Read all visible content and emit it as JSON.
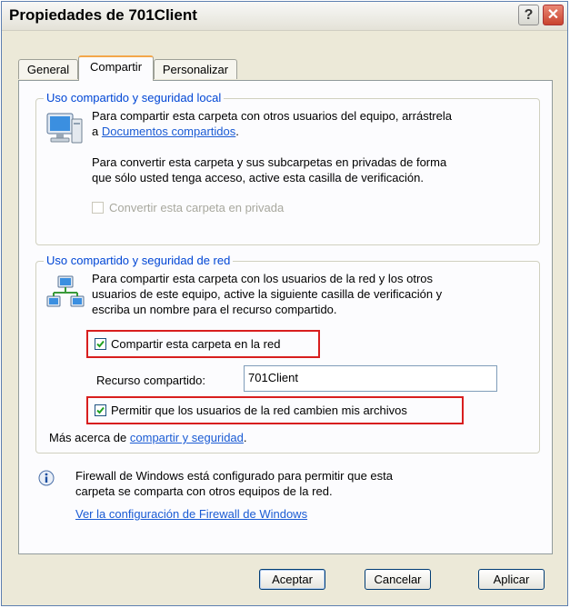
{
  "window": {
    "title": "Propiedades de 701Client",
    "help_symbol": "?",
    "close_symbol": "✕"
  },
  "tabs": [
    {
      "label": "General"
    },
    {
      "label": "Compartir",
      "active": true
    },
    {
      "label": "Personalizar"
    }
  ],
  "local": {
    "legend": "Uso compartido y seguridad local",
    "text1": "Para compartir esta carpeta con otros usuarios del equipo, arrástrela",
    "text1_prefix": "a",
    "link": "Documentos compartidos",
    "text1_suffix": ".",
    "text2_line1": "Para convertir esta carpeta y sus subcarpetas en privadas de forma",
    "text2_line2": "que sólo usted tenga acceso, active esta casilla de verificación.",
    "private_checkbox": "Convertir esta carpeta en privada"
  },
  "network": {
    "legend": "Uso compartido y seguridad de red",
    "text_line1": "Para compartir esta carpeta con los usuarios de la red y los otros",
    "text_line2": "usuarios de este equipo, active la siguiente casilla de verificación y",
    "text_line3": "escriba un nombre para el recurso compartido.",
    "share_checkbox": "Compartir esta carpeta en la red",
    "share_checked": true,
    "resource_label": "Recurso compartido:",
    "resource_value": "701Client",
    "allow_checkbox": "Permitir que los usuarios de la red cambien mis archivos",
    "allow_checked": true,
    "more_prefix": "Más acerca de",
    "more_link": "compartir y seguridad",
    "more_suffix": "."
  },
  "firewall": {
    "line1": "Firewall de Windows está configurado para permitir que esta",
    "line2": "carpeta se comparta con otros equipos de la red.",
    "link": "Ver la configuración de Firewall de Windows"
  },
  "buttons": {
    "ok": "Aceptar",
    "cancel": "Cancelar",
    "apply": "Aplicar"
  },
  "colors": {
    "accent_link": "#1a5bd4",
    "legend": "#0046d5",
    "highlight_box": "#d81e1e",
    "tab_active_top": "#f3a74a"
  }
}
